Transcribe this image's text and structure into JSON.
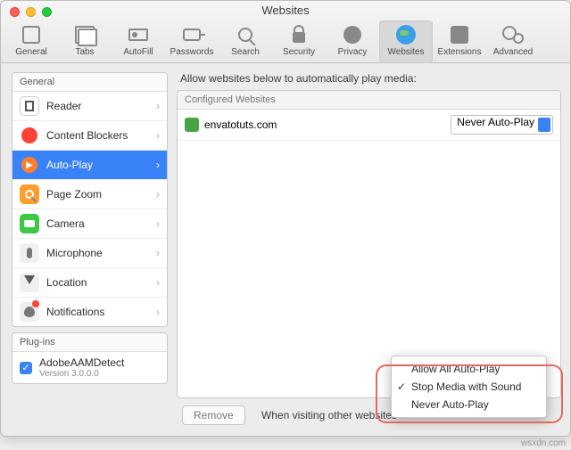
{
  "window": {
    "title": "Websites"
  },
  "toolbar": {
    "items": [
      {
        "label": "General"
      },
      {
        "label": "Tabs"
      },
      {
        "label": "AutoFill"
      },
      {
        "label": "Passwords"
      },
      {
        "label": "Search"
      },
      {
        "label": "Security"
      },
      {
        "label": "Privacy"
      },
      {
        "label": "Websites"
      },
      {
        "label": "Extensions"
      },
      {
        "label": "Advanced"
      }
    ],
    "selected": 7
  },
  "sidebar": {
    "general_head": "General",
    "items": [
      {
        "label": "Reader"
      },
      {
        "label": "Content Blockers"
      },
      {
        "label": "Auto-Play"
      },
      {
        "label": "Page Zoom"
      },
      {
        "label": "Camera"
      },
      {
        "label": "Microphone"
      },
      {
        "label": "Location"
      },
      {
        "label": "Notifications"
      }
    ],
    "active": 2,
    "plugins_head": "Plug-ins",
    "plugin": {
      "label": "AdobeAAMDetect",
      "version": "Version 3.0.0.0",
      "checked": true
    }
  },
  "main": {
    "instruction": "Allow websites below to automatically play media:",
    "panel_head": "Configured Websites",
    "rows": [
      {
        "site": "envatotuts.com",
        "setting": "Never Auto-Play"
      }
    ],
    "remove_label": "Remove",
    "other_label": "When visiting other websites",
    "menu": {
      "options": [
        {
          "label": "Allow All Auto-Play",
          "checked": false
        },
        {
          "label": "Stop Media with Sound",
          "checked": true
        },
        {
          "label": "Never Auto-Play",
          "checked": false
        }
      ]
    }
  },
  "watermark": "wsxdn.com"
}
